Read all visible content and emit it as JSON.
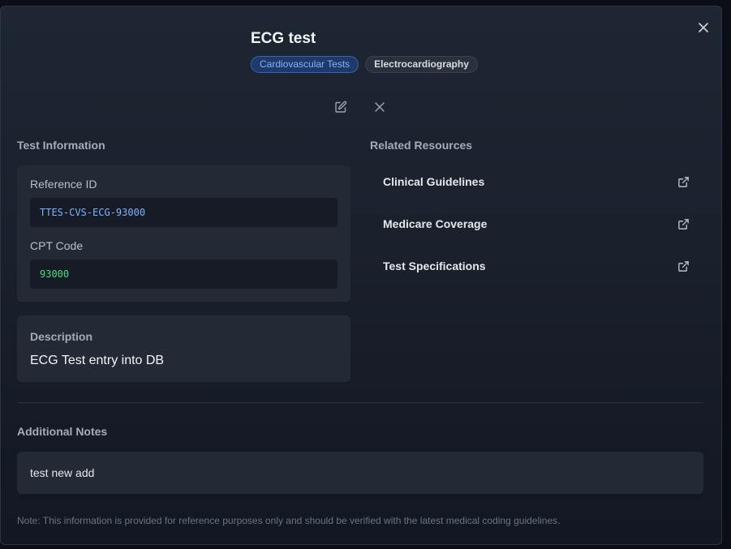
{
  "header": {
    "title": "ECG test",
    "badges": [
      "Cardiovascular Tests",
      "Electrocardiography"
    ]
  },
  "test_info": {
    "section_title": "Test Information",
    "reference_id_label": "Reference ID",
    "reference_id_value": "TTES-CVS-ECG-93000",
    "cpt_code_label": "CPT Code",
    "cpt_code_value": "93000",
    "description_label": "Description",
    "description_value": "ECG Test entry into DB"
  },
  "resources": {
    "section_title": "Related Resources",
    "items": [
      "Clinical Guidelines",
      "Medicare Coverage",
      "Test Specifications"
    ]
  },
  "notes": {
    "section_title": "Additional Notes",
    "value": "test new add"
  },
  "footnote": "Note: This information is provided for reference purposes only and should be verified with the latest medical coding guidelines.",
  "colors": {
    "accent_blue": "#7fb2ff",
    "code_green": "#4ade80",
    "background": "#1a202c"
  }
}
